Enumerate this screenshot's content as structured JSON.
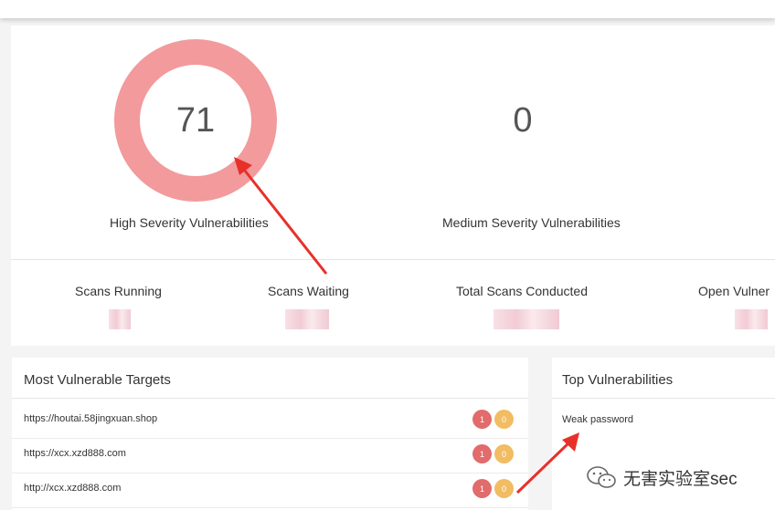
{
  "severity": {
    "high": {
      "value": "71",
      "label": "High Severity Vulnerabilities",
      "color": "#f29a9c"
    },
    "medium": {
      "value": "0",
      "label": "Medium Severity Vulnerabilities"
    }
  },
  "stats": [
    {
      "label": "Scans Running"
    },
    {
      "label": "Scans Waiting"
    },
    {
      "label": "Total Scans Conducted"
    },
    {
      "label": "Open Vulner"
    }
  ],
  "most_vulnerable": {
    "title": "Most Vulnerable Targets",
    "rows": [
      {
        "url": "https://houtai.58jingxuan.shop",
        "high": "1",
        "medium": "0"
      },
      {
        "url": "https://xcx.xzd888.com",
        "high": "1",
        "medium": "0"
      },
      {
        "url": "http://xcx.xzd888.com",
        "high": "1",
        "medium": "0"
      }
    ]
  },
  "top_vulnerabilities": {
    "title": "Top Vulnerabilities",
    "items": [
      {
        "name": "Weak password"
      }
    ]
  },
  "watermark": {
    "text": "无害实验室sec",
    "icon": "wechat-icon"
  },
  "colors": {
    "high_badge": "#e26b6b",
    "medium_badge": "#f2bc62",
    "annotation_arrow": "#e8302a"
  }
}
